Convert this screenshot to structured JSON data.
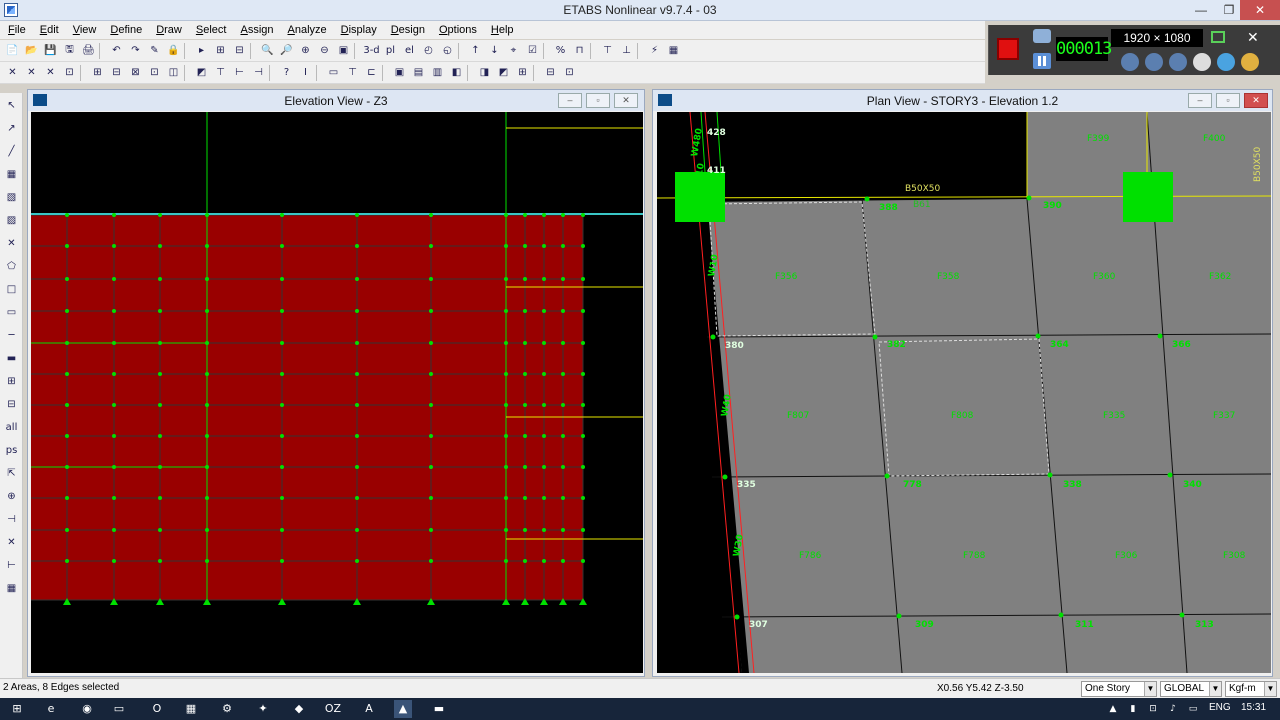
{
  "window": {
    "title": "ETABS Nonlinear v9.7.4 - 03",
    "minimize": "—",
    "maximize": "❐",
    "close": "✕"
  },
  "menu": [
    "File",
    "Edit",
    "View",
    "Define",
    "Draw",
    "Select",
    "Assign",
    "Analyze",
    "Display",
    "Design",
    "Options",
    "Help"
  ],
  "toolbar1": [
    "📄",
    "📂",
    "💾",
    "🖫",
    "🖨",
    "↶",
    "↷",
    "✎",
    "🔒",
    "▸",
    "⊞",
    "⊟",
    "🔍",
    "🔎",
    "⊕",
    "⊖",
    "▣",
    "3-d",
    "pl",
    "el",
    "◴",
    "◵",
    "↑",
    "↓",
    "⌖",
    "☑",
    "%",
    "⊓",
    "⊤",
    "⊥",
    "⚡",
    "▦"
  ],
  "toolbar2": [
    "✕",
    "✕",
    "✕",
    "⊡",
    "⊞",
    "⊟",
    "⊠",
    "⊡",
    "◫",
    "◩",
    "⊤",
    "⊢",
    "⊣",
    "?",
    "I",
    "▭",
    "⊤",
    "⊏",
    "▣",
    "▤",
    "▥",
    "◧",
    "◨",
    "◩",
    "⊞",
    "⊟",
    "⊡"
  ],
  "recorder": {
    "timer": "000013",
    "resolution": "1920 × 1080"
  },
  "left_toolbar": [
    "↖",
    "↗",
    "╱",
    "▦",
    "▧",
    "▨",
    "✕",
    "⬠",
    "□",
    "▭",
    "─",
    "▬",
    "⊞",
    "⊟",
    "all",
    "ps",
    "⇱",
    "⊕",
    "⊣",
    "✕",
    "⊢",
    "▦"
  ],
  "elevation_pane": {
    "title": "Elevation View - Z3",
    "minimize": "–",
    "maximize": "▫",
    "close": "✕"
  },
  "plan_pane": {
    "title": "Plan View - STORY3 - Elevation 1.2",
    "minimize": "–",
    "maximize": "▫",
    "close": "✕",
    "beam_label": "B50X50",
    "beam_label_2": "B61",
    "right_label": "B50X50",
    "wall_label_1": "W480",
    "wall_label_2": "W410",
    "wall_label_3": "W10",
    "wall_label_4": "W40",
    "wall_label_5": "W30",
    "points": [
      "428",
      "411",
      "388",
      "390",
      "380",
      "382",
      "364",
      "366",
      "335",
      "778",
      "338",
      "340",
      "307",
      "309",
      "311",
      "313"
    ],
    "areas": [
      "F399",
      "F400",
      "F356",
      "F358",
      "F360",
      "F362",
      "F807",
      "F808",
      "F335",
      "F337",
      "F786",
      "F788",
      "F306",
      "F308"
    ]
  },
  "status": {
    "selection": "2 Areas, 8 Edges selected",
    "coords": "X0.56  Y5.42  Z-3.50",
    "story_mode": "One Story",
    "coord_system": "GLOBAL",
    "units": "Kgf-m"
  },
  "taskbar": {
    "apps": [
      "⊞",
      "e",
      "◉",
      "▭",
      "O",
      "▦",
      "⚙",
      "✦",
      "◆",
      "OZ",
      "A",
      "▲",
      "▬"
    ],
    "language": "ENG",
    "time": "15:31",
    "tray": [
      "▲",
      "▮",
      "⊡",
      "♪",
      "▭"
    ]
  },
  "colors": {
    "wall_fill": "#990000",
    "grid_green": "#00e000",
    "plan_gray": "#808080",
    "highlight": "#00ff00"
  }
}
